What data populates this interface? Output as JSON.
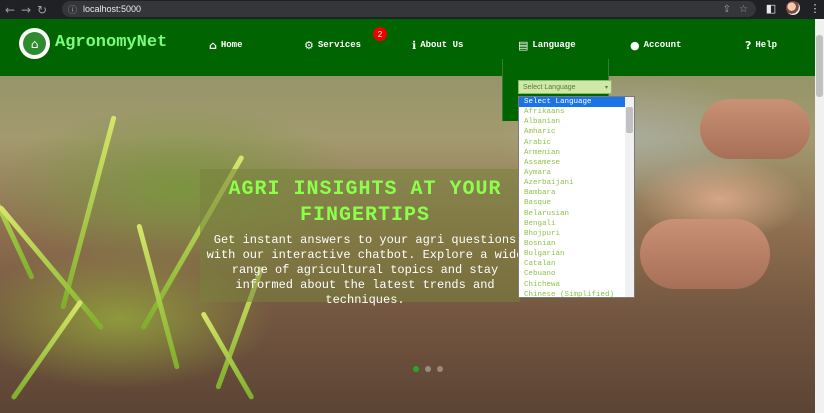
{
  "browser": {
    "url": "localhost:5000",
    "back": "←",
    "forward": "→",
    "reload": "↻",
    "info_icon": "ⓘ",
    "share_icon": "⇪",
    "star_icon": "☆",
    "sidepanel_icon": "◧"
  },
  "header": {
    "brand": "AgronomyNet",
    "logo_glyph": "⌂",
    "nav": {
      "home": {
        "icon": "⌂",
        "label": "Home"
      },
      "services": {
        "icon": "⚙",
        "label": "Services",
        "badge": "2"
      },
      "about": {
        "icon": "ℹ",
        "label": "About Us"
      },
      "language": {
        "icon": "▤",
        "label": "Language"
      },
      "account": {
        "icon": "●",
        "label": "Account"
      },
      "help": {
        "icon": "?",
        "label": "Help"
      }
    }
  },
  "language_select": {
    "value": "Select Language",
    "arrow": "▾",
    "options": [
      "Select Language",
      "Afrikaans",
      "Albanian",
      "Amharic",
      "Arabic",
      "Armenian",
      "Assamese",
      "Aymara",
      "Azerbaijani",
      "Bambara",
      "Basque",
      "Belarusian",
      "Bengali",
      "Bhojpuri",
      "Bosnian",
      "Bulgarian",
      "Catalan",
      "Cebuano",
      "Chichewa",
      "Chinese (Simplified)"
    ]
  },
  "hero": {
    "title": "AGRI INSIGHTS AT YOUR FINGERTIPS",
    "text": "Get instant answers to your agri questions with our interactive chatbot. Explore a wide range of agricultural topics and stay informed about the latest trends and techniques."
  },
  "colors": {
    "header_bg": "#006400",
    "brand": "#7CFC7C",
    "hero_title": "#8CFF4A",
    "badge": "#ee0000",
    "option_text": "#8fc24a",
    "option_selected": "#1a73e8"
  }
}
